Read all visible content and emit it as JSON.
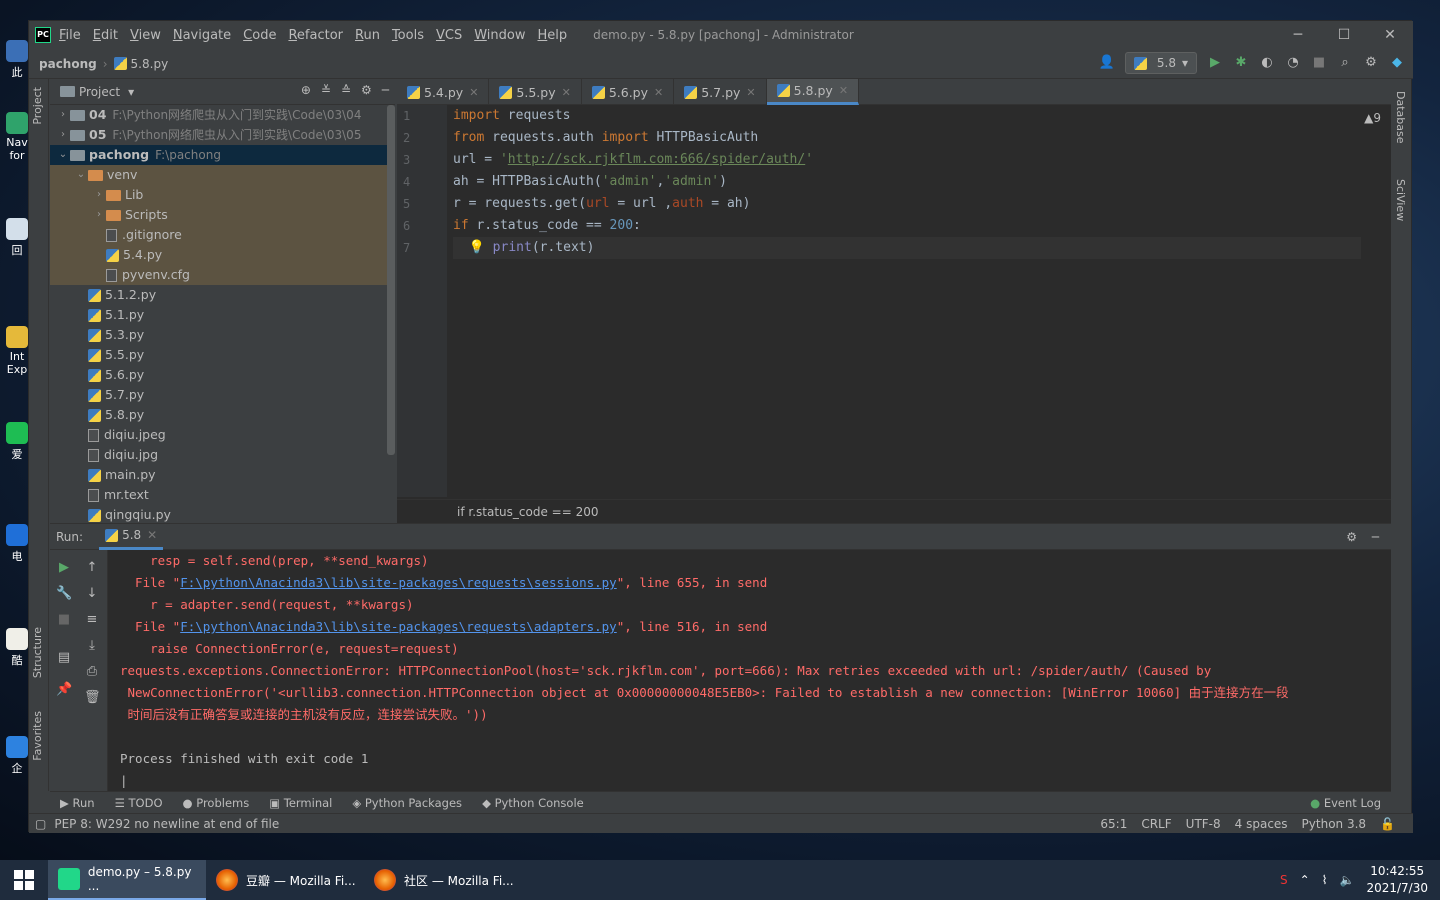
{
  "window": {
    "title": "demo.py - 5.8.py [pachong] - Administrator",
    "logo": "PC"
  },
  "menu": [
    {
      "mn": "F",
      "rest": "ile"
    },
    {
      "mn": "E",
      "rest": "dit"
    },
    {
      "mn": "V",
      "rest": "iew"
    },
    {
      "mn": "N",
      "rest": "avigate"
    },
    {
      "mn": "C",
      "rest": "ode"
    },
    {
      "mn": "R",
      "rest": "efactor"
    },
    {
      "mn": "R",
      "rest": "un"
    },
    {
      "mn": "T",
      "rest": "ools"
    },
    {
      "mn": "V",
      "rest": "CS"
    },
    {
      "mn": "W",
      "rest": "indow"
    },
    {
      "mn": "H",
      "rest": "elp"
    }
  ],
  "nav": {
    "project": "pachong",
    "file": "5.8.py",
    "run_config": "5.8"
  },
  "project_panel": {
    "title": "Project"
  },
  "tree": [
    {
      "indent": 0,
      "arrow": "›",
      "type": "folder",
      "name": "04",
      "path": "F:\\Python网络爬虫从入门到实践\\Code\\03\\04",
      "style": ""
    },
    {
      "indent": 0,
      "arrow": "›",
      "type": "folder",
      "name": "05",
      "path": "F:\\Python网络爬虫从入门到实践\\Code\\03\\05",
      "style": ""
    },
    {
      "indent": 0,
      "arrow": "⌄",
      "type": "folder",
      "name": "pachong",
      "path": "F:\\pachong",
      "style": "sel"
    },
    {
      "indent": 1,
      "arrow": "⌄",
      "type": "folder-or",
      "name": "venv",
      "path": "",
      "style": "venv"
    },
    {
      "indent": 2,
      "arrow": "›",
      "type": "folder-or",
      "name": "Lib",
      "path": "",
      "style": "venv"
    },
    {
      "indent": 2,
      "arrow": "›",
      "type": "folder-or",
      "name": "Scripts",
      "path": "",
      "style": "venv"
    },
    {
      "indent": 2,
      "arrow": "",
      "type": "file",
      "name": ".gitignore",
      "path": "",
      "style": "venv"
    },
    {
      "indent": 2,
      "arrow": "",
      "type": "py",
      "name": "5.4.py",
      "path": "",
      "style": "venv"
    },
    {
      "indent": 2,
      "arrow": "",
      "type": "file",
      "name": "pyvenv.cfg",
      "path": "",
      "style": "venv"
    },
    {
      "indent": 1,
      "arrow": "",
      "type": "py",
      "name": "5.1.2.py",
      "path": "",
      "style": ""
    },
    {
      "indent": 1,
      "arrow": "",
      "type": "py",
      "name": "5.1.py",
      "path": "",
      "style": ""
    },
    {
      "indent": 1,
      "arrow": "",
      "type": "py",
      "name": "5.3.py",
      "path": "",
      "style": ""
    },
    {
      "indent": 1,
      "arrow": "",
      "type": "py",
      "name": "5.5.py",
      "path": "",
      "style": ""
    },
    {
      "indent": 1,
      "arrow": "",
      "type": "py",
      "name": "5.6.py",
      "path": "",
      "style": ""
    },
    {
      "indent": 1,
      "arrow": "",
      "type": "py",
      "name": "5.7.py",
      "path": "",
      "style": ""
    },
    {
      "indent": 1,
      "arrow": "",
      "type": "py",
      "name": "5.8.py",
      "path": "",
      "style": ""
    },
    {
      "indent": 1,
      "arrow": "",
      "type": "file",
      "name": "diqiu.jpeg",
      "path": "",
      "style": ""
    },
    {
      "indent": 1,
      "arrow": "",
      "type": "file",
      "name": "diqiu.jpg",
      "path": "",
      "style": ""
    },
    {
      "indent": 1,
      "arrow": "",
      "type": "py",
      "name": "main.py",
      "path": "",
      "style": ""
    },
    {
      "indent": 1,
      "arrow": "",
      "type": "file",
      "name": "mr.text",
      "path": "",
      "style": ""
    },
    {
      "indent": 1,
      "arrow": "",
      "type": "py",
      "name": "qingqiu.py",
      "path": "",
      "style": ""
    }
  ],
  "editor_tabs": [
    {
      "label": "5.4.py",
      "active": false
    },
    {
      "label": "5.5.py",
      "active": false
    },
    {
      "label": "5.6.py",
      "active": false
    },
    {
      "label": "5.7.py",
      "active": false
    },
    {
      "label": "5.8.py",
      "active": true
    }
  ],
  "line_numbers": [
    "1",
    "2",
    "3",
    "4",
    "5",
    "6",
    "7"
  ],
  "warnings": "▲9",
  "editor_breadcrumb": "if r.status_code == 200",
  "run": {
    "label": "Run:",
    "tab": "5.8"
  },
  "console": [
    {
      "t": "    resp = self.send(prep, **send_kwargs)",
      "c": ""
    },
    {
      "t": "",
      "c": "file",
      "a": "  File \"",
      "u": "F:\\python\\Anacinda3\\lib\\site-packages\\requests\\sessions.py",
      "b": "\", line 655, in send"
    },
    {
      "t": "    r = adapter.send(request, **kwargs)",
      "c": ""
    },
    {
      "t": "",
      "c": "file",
      "a": "  File \"",
      "u": "F:\\python\\Anacinda3\\lib\\site-packages\\requests\\adapters.py",
      "b": "\", line 516, in send"
    },
    {
      "t": "    raise ConnectionError(e, request=request)",
      "c": ""
    },
    {
      "t": "requests.exceptions.ConnectionError: HTTPConnectionPool(host='sck.rjkflm.com', port=666): Max retries exceeded with url: /spider/auth/ (Caused by",
      "c": ""
    },
    {
      "t": " NewConnectionError('<urllib3.connection.HTTPConnection object at 0x00000000048E5EB0>: Failed to establish a new connection: [WinError 10060] 由于连接方在一段",
      "c": ""
    },
    {
      "t": " 时间后没有正确答复或连接的主机没有反应，连接尝试失败。'))",
      "c": ""
    },
    {
      "t": "",
      "c": ""
    },
    {
      "t": "Process finished with exit code 1",
      "c": "plain"
    },
    {
      "t": "|",
      "c": "plain"
    }
  ],
  "bottom_tabs": [
    "Run",
    "TODO",
    "Problems",
    "Terminal",
    "Python Packages",
    "Python Console"
  ],
  "event_log": "Event Log",
  "status": {
    "message": "PEP 8: W292 no newline at end of file",
    "pos": "65:1",
    "eol": "CRLF",
    "enc": "UTF-8",
    "indent": "4 spaces",
    "interp": "Python 3.8"
  },
  "side_tabs": {
    "project": "Project",
    "structure": "Structure",
    "favorites": "Favorites",
    "database": "Database",
    "sciview": "SciView"
  },
  "desktop_icons": [
    "此",
    "Nav for",
    "回",
    "Int Exp",
    "爱",
    "电",
    "酷",
    "企"
  ],
  "taskbar": {
    "items": [
      "demo.py – 5.8.py ...",
      "豆瓣 — Mozilla Fi...",
      "社区 — Mozilla Fi..."
    ],
    "time": "10:42:55",
    "date": "2021/7/30"
  }
}
